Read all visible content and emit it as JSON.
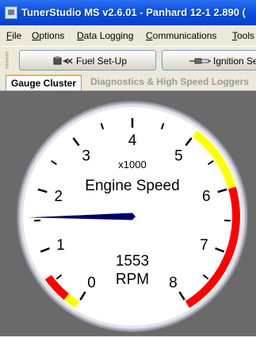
{
  "window": {
    "title": "TunerStudio MS v2.6.01 - Panhard 12-1 2.890 ("
  },
  "menu": {
    "items": [
      "File",
      "Options",
      "Data Logging",
      "Communications",
      "Tools"
    ]
  },
  "toolbar": {
    "fuel_setup_label": "Fuel Set-Up",
    "ignition_setup_label": "Ignition Se"
  },
  "tabs": {
    "active": "Gauge Cluster",
    "inactive": "Diagnostics & High Speed Loggers"
  },
  "gauge": {
    "title": "Engine Speed",
    "multiplier": "x1000",
    "value_text": "1553",
    "units": "RPM",
    "value": 1553,
    "min": 0,
    "max": 8000,
    "tick_labels": [
      "0",
      "1",
      "2",
      "3",
      "4",
      "5",
      "6",
      "7",
      "8"
    ],
    "warning_range": [
      5000,
      6000
    ],
    "danger_range": [
      6000,
      8000
    ],
    "low_warning_range": [
      0,
      200
    ],
    "low_danger_range": [
      200,
      600
    ],
    "colors": {
      "face": "#ffffff",
      "needle": "#000066",
      "warning": "#ffff00",
      "danger": "#ff0000",
      "bezel": "#d0d0d0"
    }
  }
}
